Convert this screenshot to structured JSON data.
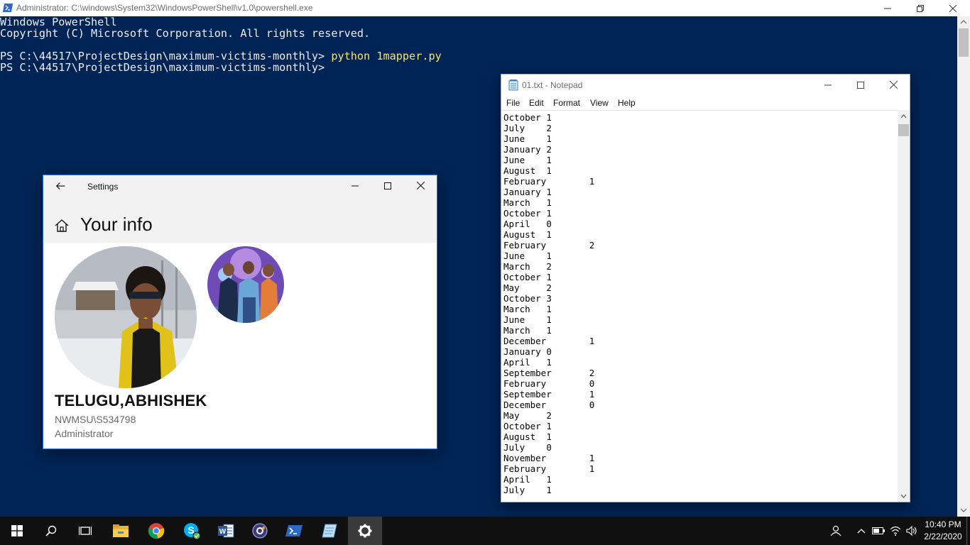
{
  "powershell": {
    "title": "Administrator: C:\\windows\\System32\\WindowsPowerShell\\v1.0\\powershell.exe",
    "banner_line1": "Windows PowerShell",
    "banner_line2": "Copyright (C) Microsoft Corporation. All rights reserved.",
    "prompt1": "PS C:\\44517\\ProjectDesign\\maximum-victims-monthly> ",
    "command1": "python 1mapper.py",
    "prompt2": "PS C:\\44517\\ProjectDesign\\maximum-victims-monthly>",
    "colors": {
      "background": "#012456",
      "text": "#eeedf0",
      "command": "#f5e46a"
    }
  },
  "settings": {
    "app_title": "Settings",
    "page_title": "Your info",
    "user_name": "TELUGU,ABHISHEK",
    "user_domain": "NWMSU\\S534798",
    "user_role": "Administrator",
    "icons": [
      "back-arrow-icon",
      "home-icon",
      "minimize-icon",
      "maximize-icon",
      "close-icon"
    ]
  },
  "notepad": {
    "title": "01.txt - Notepad",
    "menu": [
      "File",
      "Edit",
      "Format",
      "View",
      "Help"
    ],
    "lines": [
      {
        "month": "October",
        "count": "1"
      },
      {
        "month": "July",
        "count": "2"
      },
      {
        "month": "June",
        "count": "1"
      },
      {
        "month": "January",
        "count": "2"
      },
      {
        "month": "June",
        "count": "1"
      },
      {
        "month": "August",
        "count": "1"
      },
      {
        "month": "February",
        "count": "1"
      },
      {
        "month": "January",
        "count": "1"
      },
      {
        "month": "March",
        "count": "1"
      },
      {
        "month": "October",
        "count": "1"
      },
      {
        "month": "April",
        "count": "0"
      },
      {
        "month": "August",
        "count": "1"
      },
      {
        "month": "February",
        "count": "2"
      },
      {
        "month": "June",
        "count": "1"
      },
      {
        "month": "March",
        "count": "2"
      },
      {
        "month": "October",
        "count": "1"
      },
      {
        "month": "May",
        "count": "2"
      },
      {
        "month": "October",
        "count": "3"
      },
      {
        "month": "March",
        "count": "1"
      },
      {
        "month": "June",
        "count": "1"
      },
      {
        "month": "March",
        "count": "1"
      },
      {
        "month": "December",
        "count": "1"
      },
      {
        "month": "January",
        "count": "0"
      },
      {
        "month": "April",
        "count": "1"
      },
      {
        "month": "September",
        "count": "2"
      },
      {
        "month": "February",
        "count": "0"
      },
      {
        "month": "September",
        "count": "1"
      },
      {
        "month": "December",
        "count": "0"
      },
      {
        "month": "May",
        "count": "2"
      },
      {
        "month": "October",
        "count": "1"
      },
      {
        "month": "August",
        "count": "1"
      },
      {
        "month": "July",
        "count": "0"
      },
      {
        "month": "November",
        "count": "1"
      },
      {
        "month": "February",
        "count": "1"
      },
      {
        "month": "April",
        "count": "1"
      },
      {
        "month": "July",
        "count": "1"
      }
    ]
  },
  "taskbar": {
    "pinned": [
      {
        "name": "start-button",
        "icon": "windows-logo-icon"
      },
      {
        "name": "search-button",
        "icon": "search-icon"
      },
      {
        "name": "task-view-button",
        "icon": "task-view-icon"
      },
      {
        "name": "file-explorer-button",
        "icon": "folder-icon"
      },
      {
        "name": "chrome-button",
        "icon": "chrome-icon"
      },
      {
        "name": "skype-button",
        "icon": "skype-icon"
      },
      {
        "name": "word-button",
        "icon": "word-icon"
      },
      {
        "name": "app-button",
        "icon": "gear-app-icon"
      },
      {
        "name": "powershell-button",
        "icon": "powershell-icon"
      },
      {
        "name": "notepad-button",
        "icon": "notepad-icon"
      },
      {
        "name": "settings-button",
        "icon": "gear-icon"
      }
    ],
    "clock_time": "10:40 PM",
    "clock_date": "2/22/2020"
  }
}
